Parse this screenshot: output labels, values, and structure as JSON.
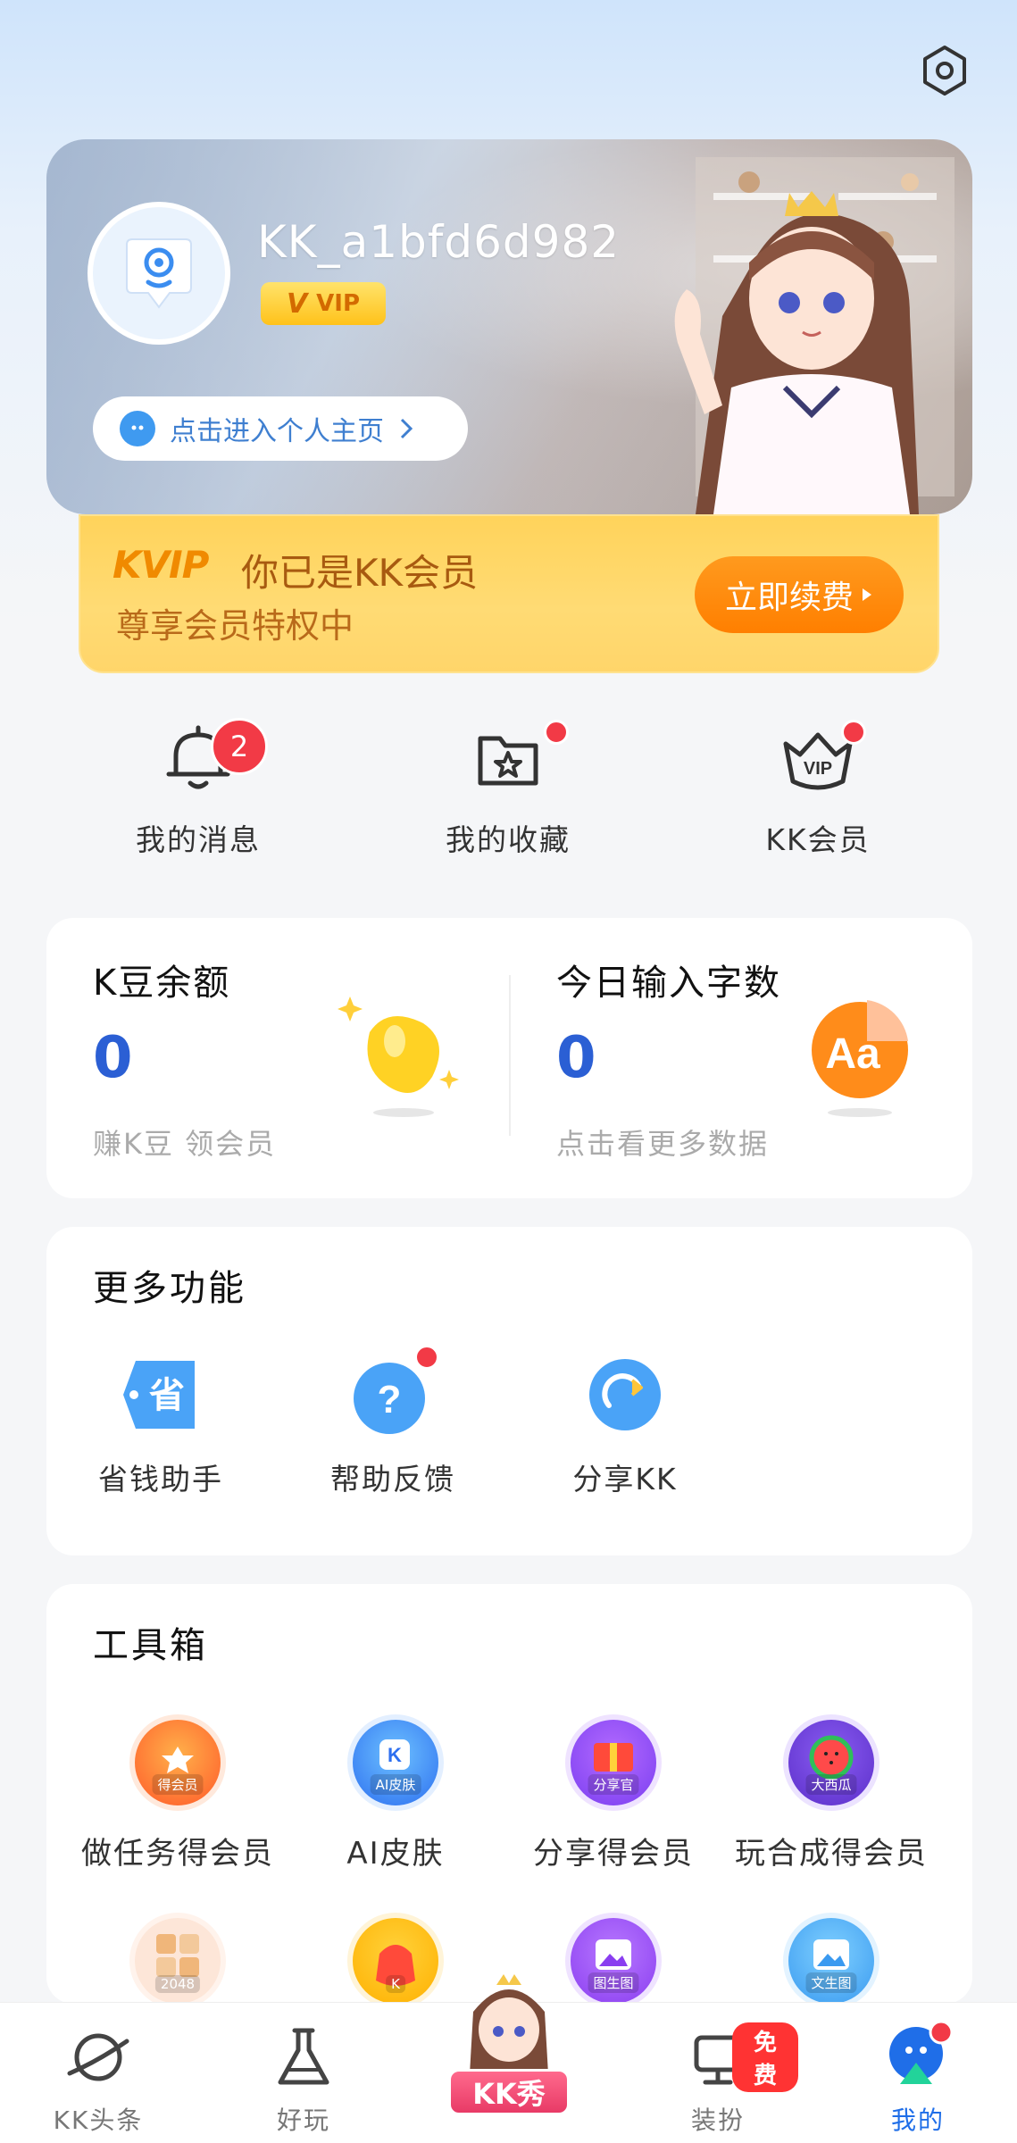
{
  "profile": {
    "username": "KK_a1bfd6d982",
    "vip_badge_v": "V",
    "vip_badge_text": "VIP",
    "home_link_label": "点击进入个人主页"
  },
  "vip_banner": {
    "logo": "KVIP",
    "headline": "你已是KK会员",
    "subline": "尊享会员特权中",
    "renew_label": "立即续费"
  },
  "quick_actions": [
    {
      "label": "我的消息",
      "badge": "2",
      "icon": "bell-icon"
    },
    {
      "label": "我的收藏",
      "icon": "folder-star-icon"
    },
    {
      "label": "KK会员",
      "icon": "vip-crown-icon"
    }
  ],
  "stats": {
    "beans_title": "K豆余额",
    "beans_value": "0",
    "beans_sub": "赚K豆 领会员",
    "chars_title": "今日输入字数",
    "chars_value": "0",
    "chars_sub": "点击看更多数据"
  },
  "more_functions": {
    "title": "更多功能",
    "items": [
      {
        "label": "省钱助手",
        "icon": "savings-tag-icon"
      },
      {
        "label": "帮助反馈",
        "icon": "help-question-icon"
      },
      {
        "label": "分享KK",
        "icon": "share-arrow-icon"
      }
    ]
  },
  "toolbox": {
    "title": "工具箱",
    "items": [
      {
        "label": "做任务得会员",
        "tag": "得会员",
        "icon": "task-reward-icon"
      },
      {
        "label": "AI皮肤",
        "tag": "AI皮肤",
        "icon": "ai-skin-icon"
      },
      {
        "label": "分享得会员",
        "tag": "分享官",
        "icon": "share-gift-icon"
      },
      {
        "label": "玩合成得会员",
        "tag": "大西瓜",
        "icon": "watermelon-game-icon"
      },
      {
        "tag": "2048",
        "icon": "game-2048-icon"
      },
      {
        "tag": "K",
        "icon": "lucky-bag-icon"
      },
      {
        "tag": "图生图",
        "icon": "image-to-image-icon"
      },
      {
        "tag": "文生图",
        "icon": "text-to-image-icon"
      }
    ]
  },
  "bottom_nav": [
    {
      "label": "KK头条",
      "icon": "planet-icon"
    },
    {
      "label": "好玩",
      "icon": "flask-icon"
    },
    {
      "label": "KK秀",
      "icon": "kk-show-character-icon"
    },
    {
      "label": "装扮",
      "icon": "dress-up-icon",
      "tag": "免费"
    },
    {
      "label": "我的",
      "icon": "profile-icon",
      "active": true
    }
  ],
  "colors": {
    "accent_blue": "#2b5fd4",
    "vip_orange": "#ff8a00",
    "badge_red": "#f23a46"
  }
}
